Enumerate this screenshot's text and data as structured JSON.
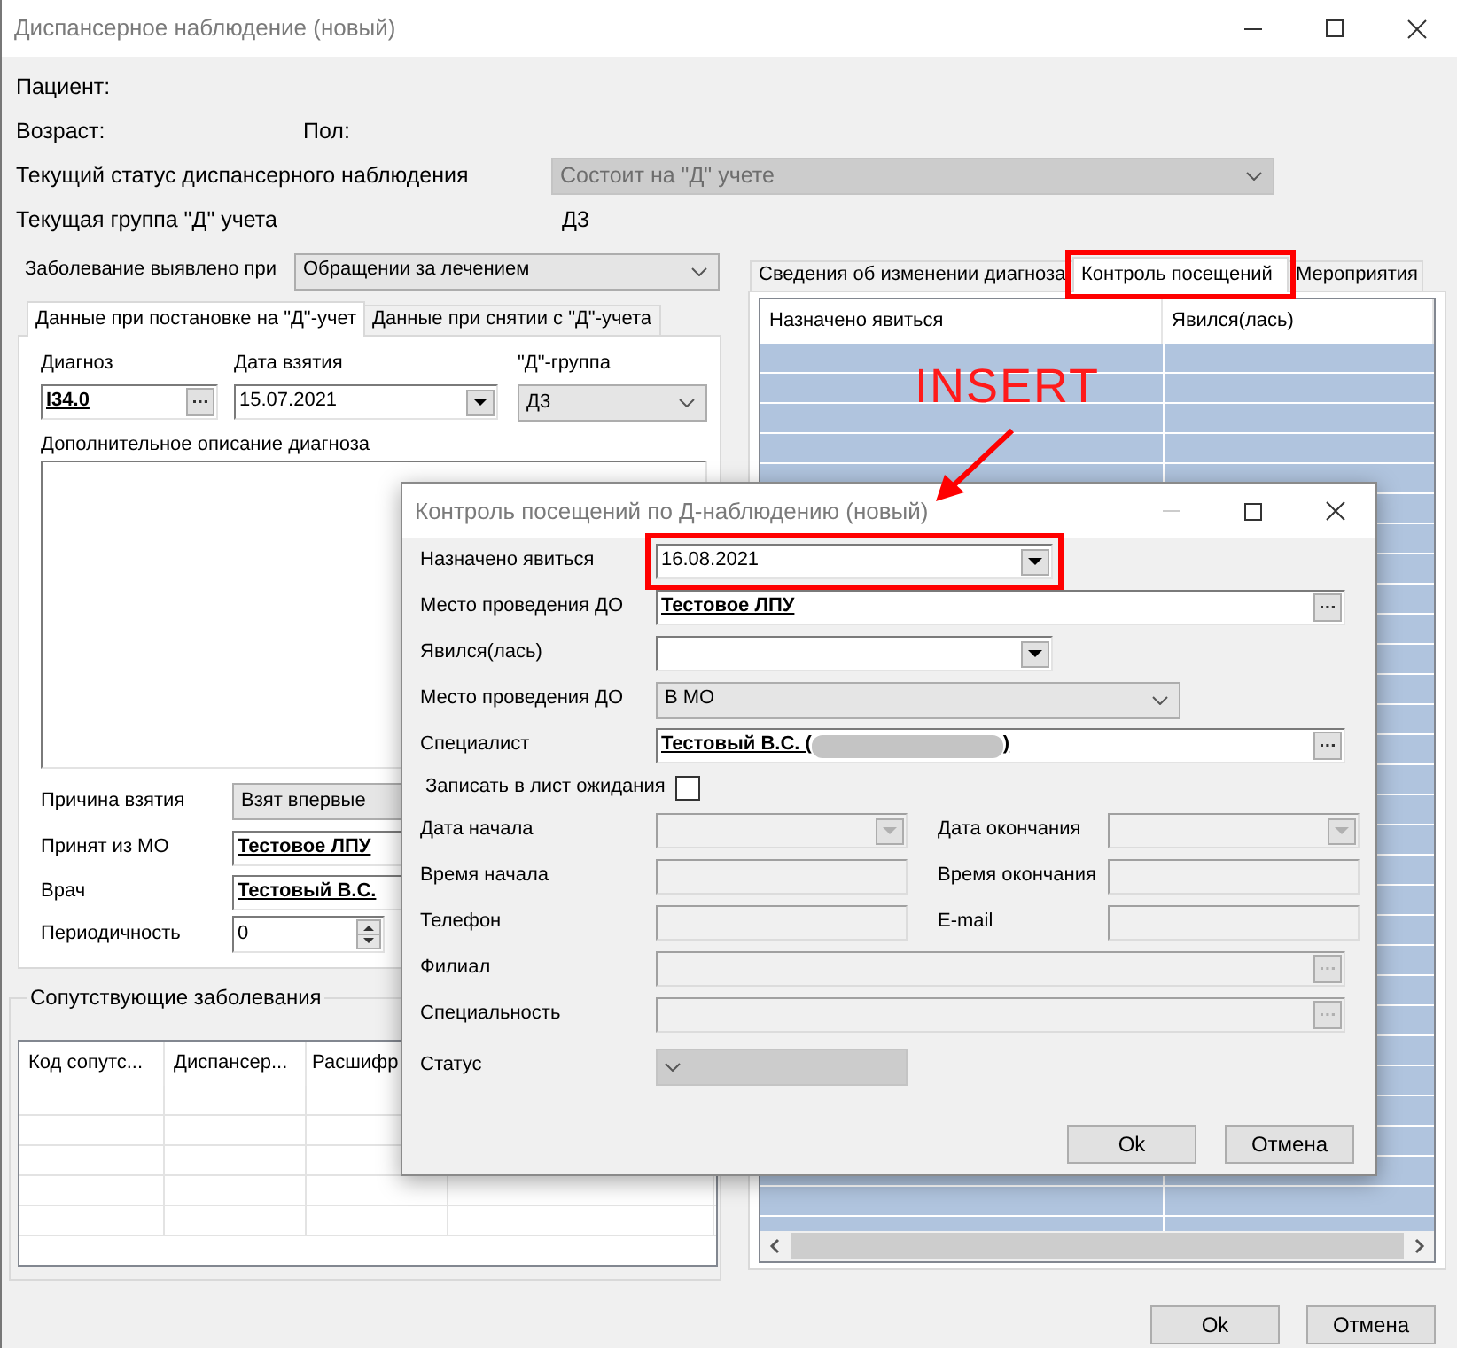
{
  "window": {
    "title": "Диспансерное наблюдение (новый)"
  },
  "patient": {
    "label": "Пациент:"
  },
  "age": {
    "label": "Возраст:"
  },
  "sex": {
    "label": "Пол:"
  },
  "status": {
    "label": "Текущий статус диспансерного наблюдения",
    "value": "Состоит на \"Д\" учете",
    "disabled": true
  },
  "group": {
    "label": "Текущая группа \"Д\" учета",
    "value": "Д3"
  },
  "detected": {
    "label": "Заболевание выявлено при",
    "value": "Обращении за лечением"
  },
  "left_tabs": [
    {
      "label": "Данные при постановке на \"Д\"-учет",
      "selected": true
    },
    {
      "label": "Данные при снятии с \"Д\"-учета",
      "selected": false
    }
  ],
  "diagnosis": {
    "label": "Диагноз",
    "value": "I34.0"
  },
  "date_taken": {
    "label": "Дата взятия",
    "value": "15.07.2021"
  },
  "d_group": {
    "label": "\"Д\"-группа",
    "value": "Д3"
  },
  "description": {
    "label": "Дополнительное описание диагноза"
  },
  "reason": {
    "label": "Причина взятия",
    "value": "Взят впервые"
  },
  "from_mo": {
    "label": "Принят из МО",
    "value": "Тестовое ЛПУ"
  },
  "doctor": {
    "label": "Врач",
    "value": "Тестовый В.С."
  },
  "periodicity": {
    "label": "Периодичность",
    "value": "0"
  },
  "comorbid": {
    "title": "Сопутствующие заболевания",
    "columns": [
      "Код сопутс...",
      "Диспансер...",
      "Расшифр"
    ]
  },
  "right_tabs": [
    {
      "label": "Сведения об изменении диагноза",
      "selected": false,
      "highlighted": false
    },
    {
      "label": "Контроль посещений",
      "selected": true,
      "highlighted": true
    },
    {
      "label": "Мероприятия",
      "selected": false,
      "highlighted": false
    }
  ],
  "visits_table": {
    "columns": [
      "Назначено явиться",
      "Явился(лась)"
    ]
  },
  "buttons": [
    {
      "label": "Ok"
    },
    {
      "label": "Отмена"
    }
  ],
  "dialog": {
    "title": "Контроль посещений по Д-наблюдению (новый)",
    "rows": [
      [
        {
          "kind": "dropdown",
          "label": "Назначено явиться",
          "value": "16.08.2021",
          "disabled": false,
          "highlighted": true
        }
      ],
      [
        {
          "kind": "lookup",
          "label": "Место проведения ДО",
          "value": "Тестовое ЛПУ",
          "disabled": false
        }
      ],
      [
        {
          "kind": "dropdown",
          "label": "Явился(лась)",
          "disabled": false
        }
      ],
      [
        {
          "kind": "select",
          "label": "Место проведения ДО",
          "value": "В МО",
          "disabled": false
        }
      ],
      [
        {
          "kind": "lookup",
          "label": "Специалист",
          "value": "Тестовый В.С. (",
          "redacted": true,
          "value_end": ")",
          "disabled": false
        }
      ],
      [
        {
          "kind": "checkbox",
          "label": "Записать в лист ожидания",
          "checked": false
        }
      ],
      [
        {
          "kind": "dropdown",
          "label": "Дата начала",
          "disabled": true
        },
        {
          "kind": "dropdown",
          "label": "Дата окончания",
          "disabled": true
        }
      ],
      [
        {
          "kind": "text",
          "label": "Время начала",
          "disabled": true
        },
        {
          "kind": "text",
          "label": "Время окончания",
          "disabled": true
        }
      ],
      [
        {
          "kind": "text",
          "label": "Телефон",
          "disabled": true
        },
        {
          "kind": "text",
          "label": "E-mail",
          "disabled": true
        }
      ],
      [
        {
          "kind": "lookup",
          "label": "Филиал",
          "disabled": true
        }
      ],
      [
        {
          "kind": "lookup",
          "label": "Специальность",
          "disabled": true
        }
      ],
      [
        {
          "kind": "select",
          "label": "Статус",
          "disabled": true
        }
      ]
    ],
    "buttons": [
      {
        "label": "Ok"
      },
      {
        "label": "Отмена"
      }
    ]
  },
  "annotation": {
    "text": "INSERT"
  }
}
